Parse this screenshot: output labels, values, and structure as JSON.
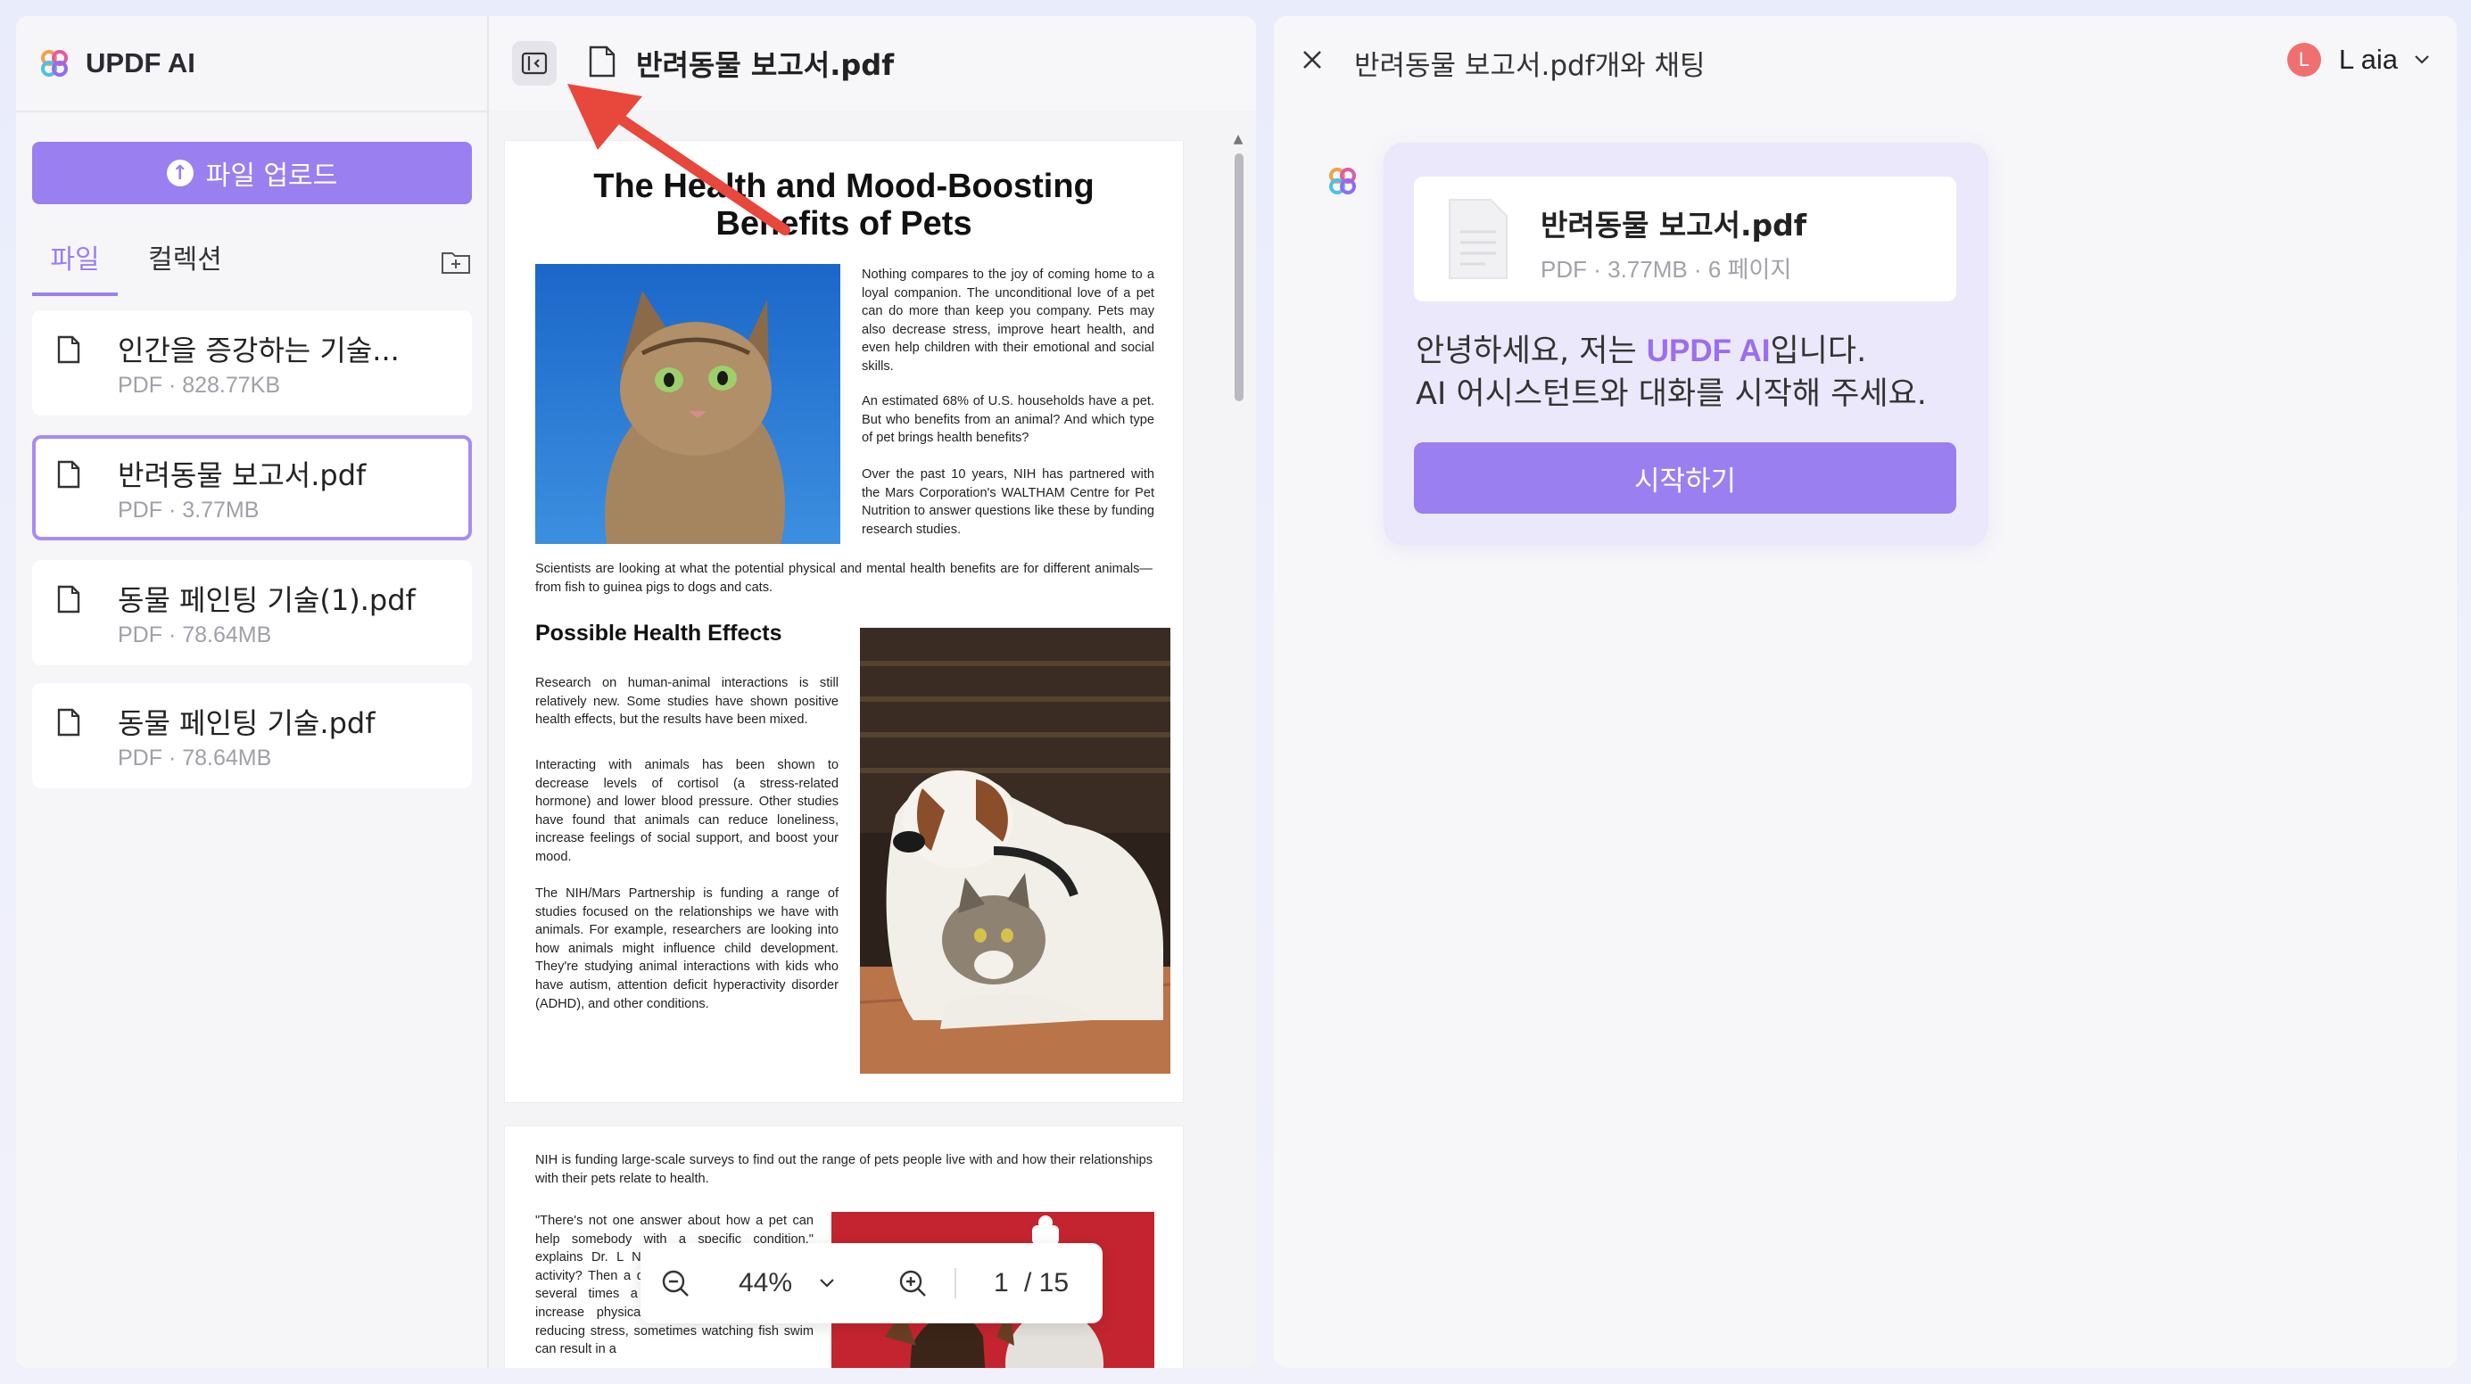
{
  "app": {
    "brand": "UPDF AI"
  },
  "sidebar": {
    "upload_label": "파일 업로드",
    "tabs": [
      {
        "label": "파일"
      },
      {
        "label": "컬렉션"
      }
    ],
    "files": [
      {
        "name": "인간을 증강하는 기술...",
        "meta": "PDF · 828.77KB"
      },
      {
        "name": "반려동물 보고서.pdf",
        "meta": "PDF · 3.77MB"
      },
      {
        "name": "동물 페인팅 기술(1).pdf",
        "meta": "PDF · 78.64MB"
      },
      {
        "name": "동물 페인팅 기술.pdf",
        "meta": "PDF · 78.64MB"
      }
    ]
  },
  "viewer": {
    "title": "반려동물 보고서.pdf",
    "page1": {
      "title_line1": "The Health and Mood-Boosting",
      "title_line2": "Benefits of Pets",
      "p1": "Nothing compares to the joy of coming home to a loyal companion. The unconditional love of a pet can do more than keep you company. Pets may also decrease stress, improve heart health, and even help children with their emotional and social skills.",
      "p2": "An estimated 68% of U.S. households have a pet. But who benefits from an animal? And which type of pet brings health benefits?",
      "p3": "Over the past 10 years, NIH has partnered with the Mars Corporation's WALTHAM Centre for Pet Nutrition to answer questions like these by funding research studies.",
      "p4": "Scientists are looking at what the potential physical and mental health benefits are for different animals—from fish to guinea pigs to dogs and cats.",
      "subhead": "Possible Health Effects",
      "p5": "Research on human-animal interactions is still relatively new. Some studies have shown positive health effects, but the results have been mixed.",
      "p6": "Interacting with animals has been shown to decrease levels of cortisol (a stress-related hormone) and lower blood pressure. Other studies have found that animals can reduce loneliness, increase feelings of social support, and boost your mood.",
      "p7": "The NIH/Mars Partnership is funding a range of studies focused on the relationships we have with animals. For example, researchers are looking into how animals might influence child development. They're studying animal interactions with kids who have autism, attention deficit hyperactivity disorder (ADHD), and other conditions."
    },
    "page2": {
      "p1": "NIH is funding large-scale surveys to find out the range of pets people live with and how their relationships with their pets relate to health.",
      "p2": "\"There's not one answer about how a pet can help somebody with a specific condition,\" explains Dr. L NIH's Human Program. \"Is y activity? Then a dog. You have to walk a dog several times a day and you're going to increase physical activity. If your goal is reducing stress, sometimes watching fish swim can result in a"
    },
    "zoom": {
      "value": "44%",
      "page_current": "1",
      "page_total": "/ 15"
    }
  },
  "chat": {
    "title": "반려동물 보고서.pdf개와 채팅",
    "user": {
      "initial": "L",
      "name": "L aia"
    },
    "file_card": {
      "name": "반려동물 보고서.pdf",
      "meta": "PDF · 3.77MB · 6 페이지"
    },
    "greeting_pre": "안녕하세요, 저는 ",
    "greeting_brand": "UPDF AI",
    "greeting_post": "입니다.",
    "greeting_line2": "AI 어시스턴트와 대화를 시작해 주세요.",
    "start_label": "시작하기"
  },
  "colors": {
    "accent": "#9a7ff0",
    "annotation_arrow": "#e8473b"
  }
}
